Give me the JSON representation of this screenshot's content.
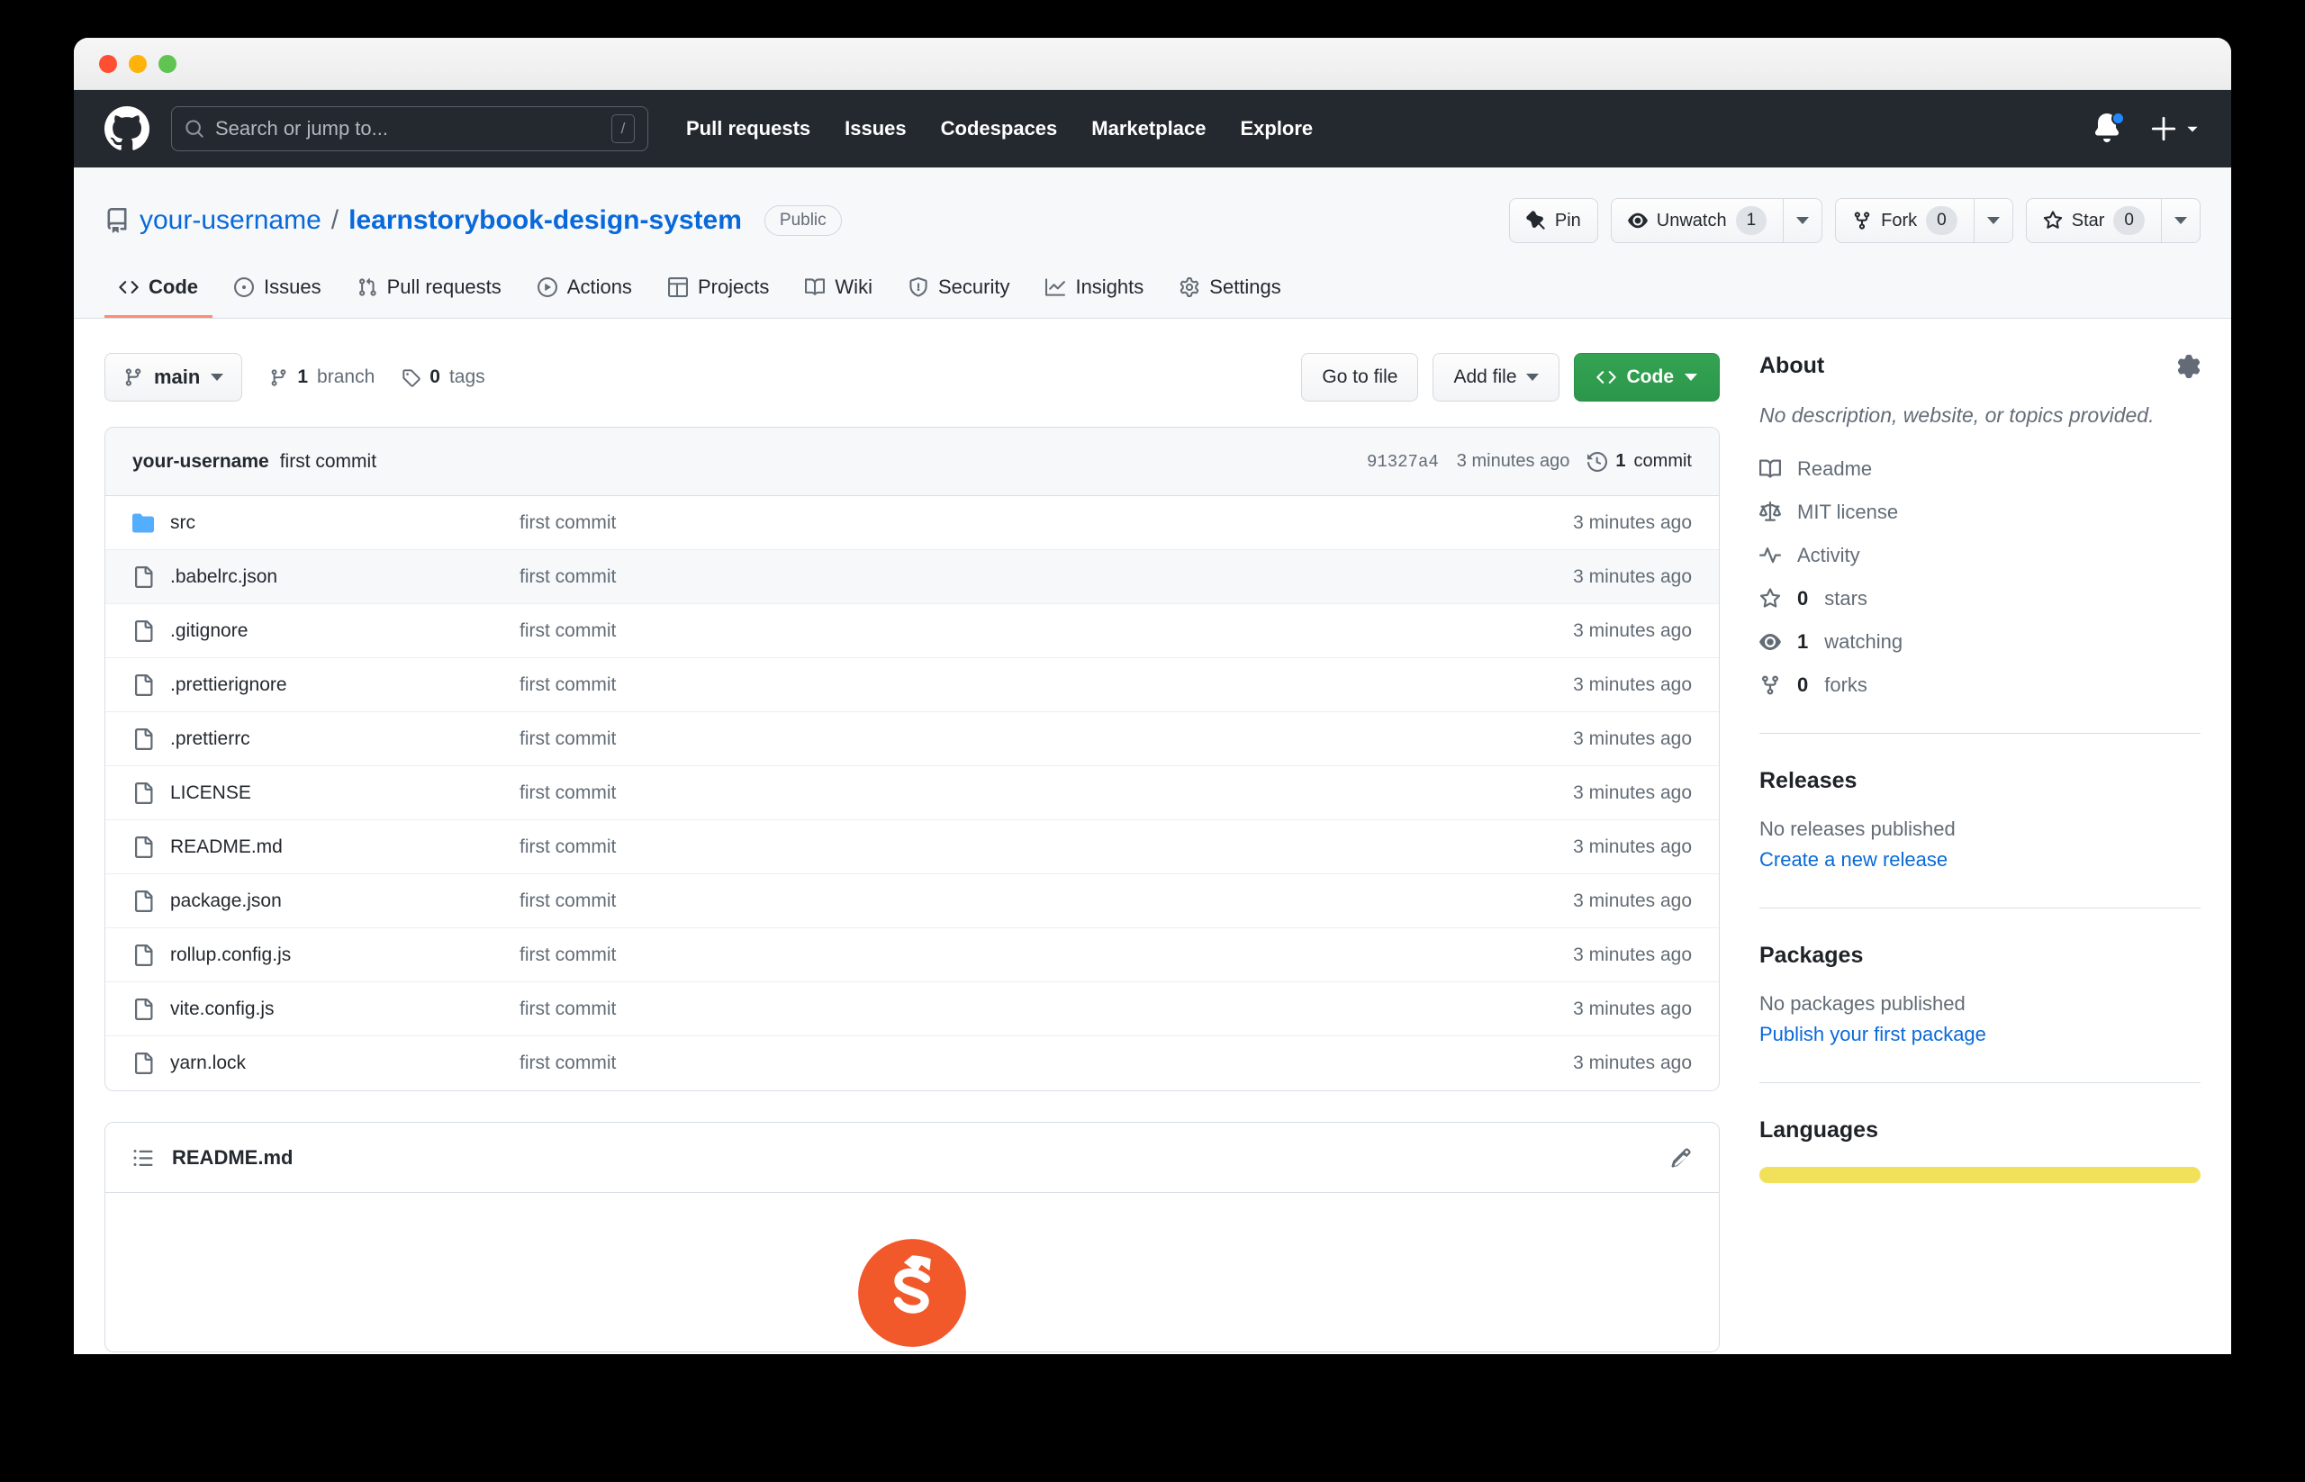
{
  "window": {
    "traffic_lights": [
      "close",
      "minimize",
      "zoom"
    ]
  },
  "header": {
    "logo_icon": "github-mark-icon",
    "search": {
      "placeholder": "Search or jump to...",
      "shortcut": "/",
      "icon": "search-icon"
    },
    "nav": [
      {
        "label": "Pull requests"
      },
      {
        "label": "Issues"
      },
      {
        "label": "Codespaces"
      },
      {
        "label": "Marketplace"
      },
      {
        "label": "Explore"
      }
    ],
    "notifications_icon": "bell-icon",
    "has_unread": true,
    "create_icon": "plus-icon",
    "create_caret_icon": "chevron-down-icon"
  },
  "repo": {
    "repo_icon": "repo-icon",
    "owner": "your-username",
    "separator": "/",
    "name": "learnstorybook-design-system",
    "visibility": "Public",
    "actions": {
      "pin": {
        "label": "Pin",
        "icon": "pin-icon"
      },
      "watch": {
        "label": "Unwatch",
        "count": "1",
        "icon": "eye-icon",
        "caret_icon": "chevron-down-icon"
      },
      "fork": {
        "label": "Fork",
        "count": "0",
        "icon": "fork-icon",
        "caret_icon": "chevron-down-icon"
      },
      "star": {
        "label": "Star",
        "count": "0",
        "icon": "star-icon",
        "caret_icon": "chevron-down-icon"
      }
    },
    "tabs": [
      {
        "label": "Code",
        "icon": "code-icon",
        "active": true
      },
      {
        "label": "Issues",
        "icon": "issue-opened-icon",
        "active": false
      },
      {
        "label": "Pull requests",
        "icon": "git-pull-request-icon",
        "active": false
      },
      {
        "label": "Actions",
        "icon": "play-icon",
        "active": false
      },
      {
        "label": "Projects",
        "icon": "table-icon",
        "active": false
      },
      {
        "label": "Wiki",
        "icon": "book-icon",
        "active": false
      },
      {
        "label": "Security",
        "icon": "shield-icon",
        "active": false
      },
      {
        "label": "Insights",
        "icon": "graph-icon",
        "active": false
      },
      {
        "label": "Settings",
        "icon": "gear-icon",
        "active": false
      }
    ]
  },
  "toolbar": {
    "branch": {
      "label": "main",
      "icon": "branch-icon",
      "caret_icon": "chevron-down-icon"
    },
    "branch_count": {
      "count": "1",
      "label": "branch",
      "icon": "branch-icon"
    },
    "tag_count": {
      "count": "0",
      "label": "tags",
      "icon": "tag-icon"
    },
    "go_to_file": "Go to file",
    "add_file": "Add file",
    "code_button": "Code",
    "code_icon": "code-icon"
  },
  "commit_bar": {
    "author": "your-username",
    "message": "first commit",
    "sha": "91327a4",
    "time": "3 minutes ago",
    "commit_count": "1",
    "commit_count_label": "commit",
    "history_icon": "history-icon"
  },
  "files": [
    {
      "name": "src",
      "type": "folder",
      "icon": "folder-icon",
      "message": "first commit",
      "time": "3 minutes ago",
      "highlighted": false
    },
    {
      "name": ".babelrc.json",
      "type": "file",
      "icon": "file-icon",
      "message": "first commit",
      "time": "3 minutes ago",
      "highlighted": true
    },
    {
      "name": ".gitignore",
      "type": "file",
      "icon": "file-icon",
      "message": "first commit",
      "time": "3 minutes ago",
      "highlighted": false
    },
    {
      "name": ".prettierignore",
      "type": "file",
      "icon": "file-icon",
      "message": "first commit",
      "time": "3 minutes ago",
      "highlighted": false
    },
    {
      "name": ".prettierrc",
      "type": "file",
      "icon": "file-icon",
      "message": "first commit",
      "time": "3 minutes ago",
      "highlighted": false
    },
    {
      "name": "LICENSE",
      "type": "file",
      "icon": "file-icon",
      "message": "first commit",
      "time": "3 minutes ago",
      "highlighted": false
    },
    {
      "name": "README.md",
      "type": "file",
      "icon": "file-icon",
      "message": "first commit",
      "time": "3 minutes ago",
      "highlighted": false
    },
    {
      "name": "package.json",
      "type": "file",
      "icon": "file-icon",
      "message": "first commit",
      "time": "3 minutes ago",
      "highlighted": false
    },
    {
      "name": "rollup.config.js",
      "type": "file",
      "icon": "file-icon",
      "message": "first commit",
      "time": "3 minutes ago",
      "highlighted": false
    },
    {
      "name": "vite.config.js",
      "type": "file",
      "icon": "file-icon",
      "message": "first commit",
      "time": "3 minutes ago",
      "highlighted": false
    },
    {
      "name": "yarn.lock",
      "type": "file",
      "icon": "file-icon",
      "message": "first commit",
      "time": "3 minutes ago",
      "highlighted": false
    }
  ],
  "readme": {
    "title": "README.md",
    "list_icon": "list-unordered-icon",
    "edit_icon": "pencil-icon",
    "content_logo": "storybook-logo"
  },
  "sidebar": {
    "about": {
      "title": "About",
      "gear_icon": "gear-icon",
      "description": "No description, website, or topics provided.",
      "items": [
        {
          "label": "Readme",
          "icon": "book-icon",
          "value": ""
        },
        {
          "label": "MIT license",
          "icon": "law-icon",
          "value": ""
        },
        {
          "label": "Activity",
          "icon": "pulse-icon",
          "value": ""
        },
        {
          "label": "stars",
          "icon": "star-icon",
          "value": "0"
        },
        {
          "label": "watching",
          "icon": "eye-icon",
          "value": "1"
        },
        {
          "label": "forks",
          "icon": "fork-icon",
          "value": "0"
        }
      ]
    },
    "releases": {
      "title": "Releases",
      "empty_text": "No releases published",
      "link": "Create a new release"
    },
    "packages": {
      "title": "Packages",
      "empty_text": "No packages published",
      "link": "Publish your first package"
    },
    "languages": {
      "title": "Languages",
      "bar_color": "#f1e05a"
    }
  }
}
